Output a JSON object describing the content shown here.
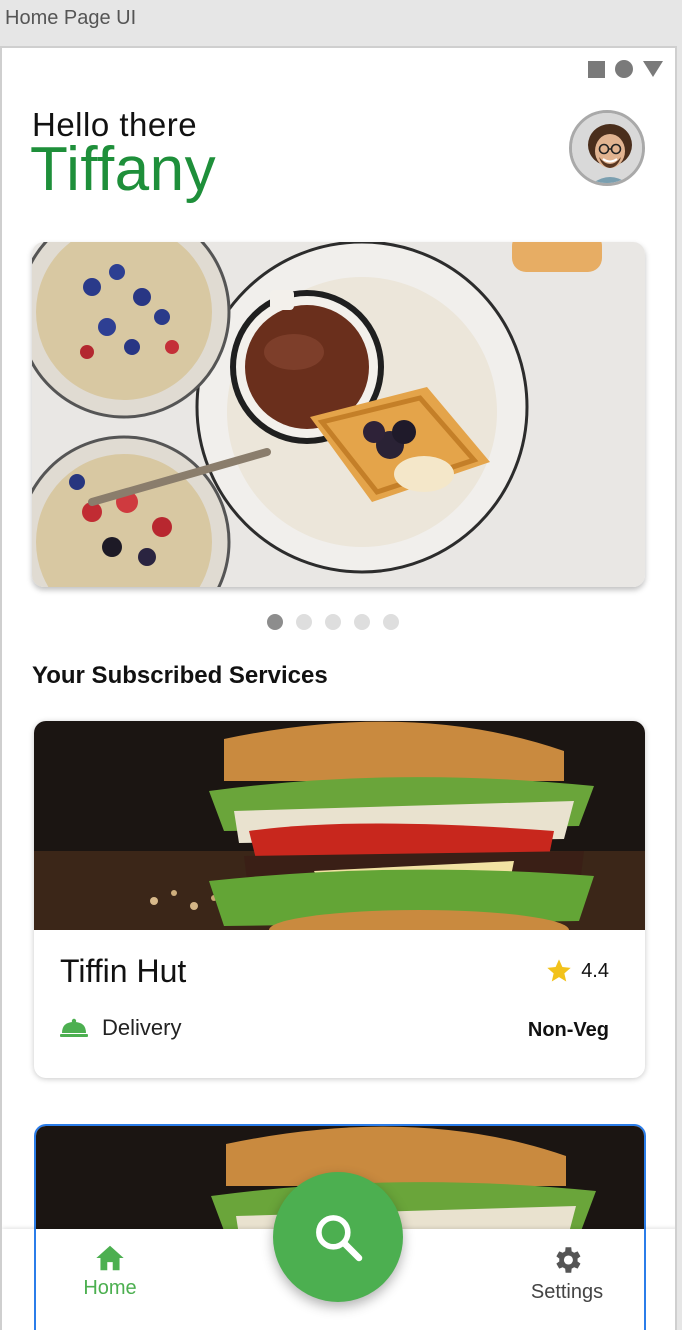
{
  "window": {
    "title": "Home Page UI"
  },
  "header": {
    "greeting": "Hello there",
    "user_name": "Tiffany",
    "avatar_icon": "user-avatar"
  },
  "carousel": {
    "slides": 5,
    "active_index": 0
  },
  "section": {
    "title": "Your Subscribed Services"
  },
  "services": [
    {
      "name": "Tiffin Hut",
      "rating": "4.4",
      "mode": "Delivery",
      "diet": "Non-Veg"
    }
  ],
  "nav": {
    "home_label": "Home",
    "settings_label": "Settings",
    "fab_icon": "search-icon"
  },
  "colors": {
    "brand_green": "#4caf50",
    "name_green": "#1e8f3a",
    "star": "#f2c21b",
    "selection_outline": "#2b7de9"
  }
}
